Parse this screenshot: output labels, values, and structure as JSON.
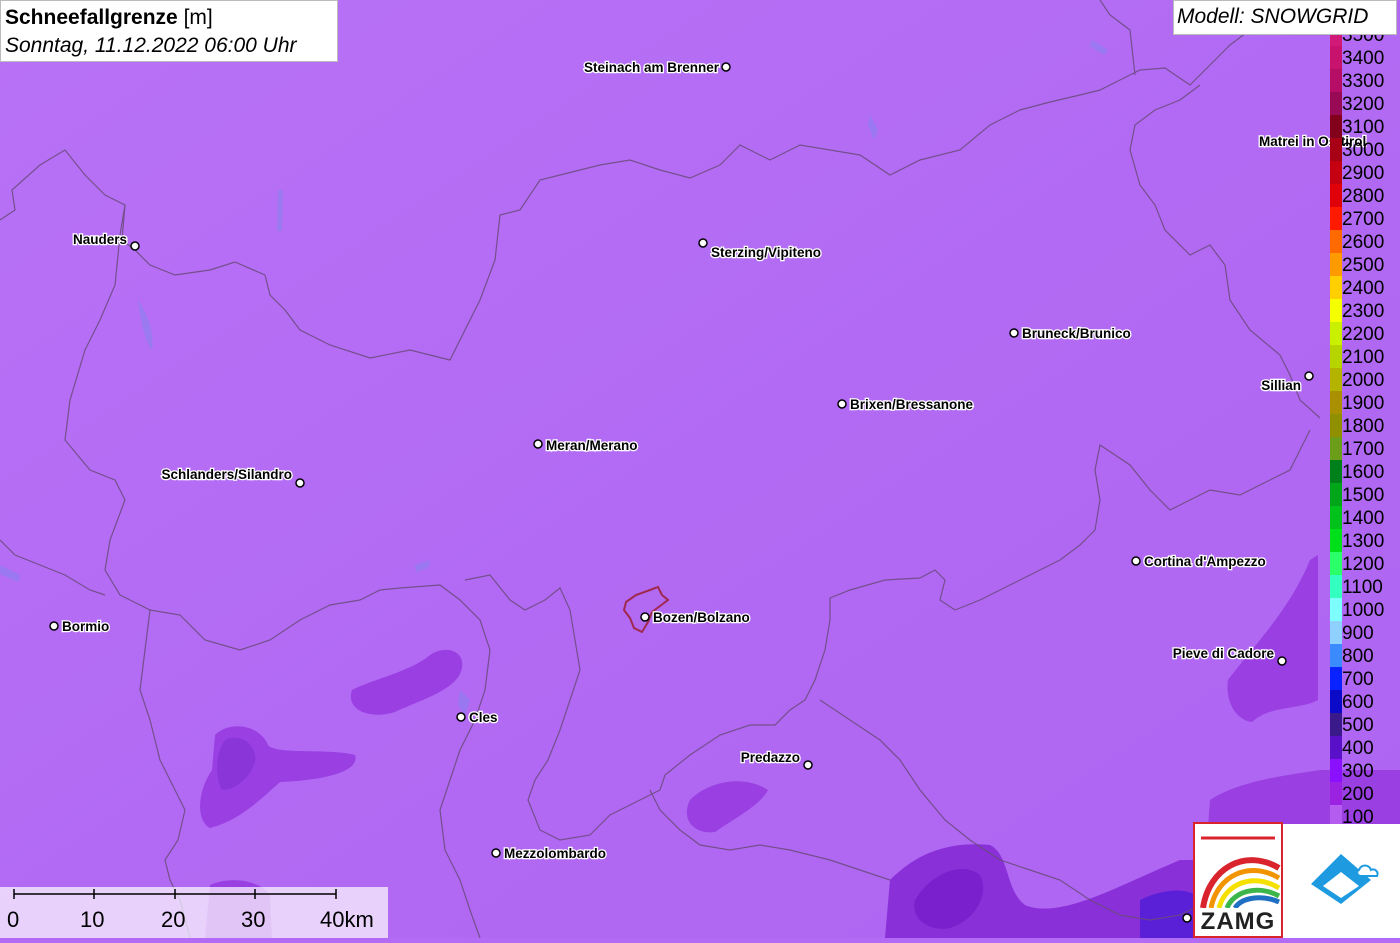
{
  "title": {
    "main": "Schneefallgrenze",
    "unit": "[m]",
    "datetime": "Sonntag, 11.12.2022 06:00 Uhr"
  },
  "model": "Modell: SNOWGRID",
  "legend": [
    {
      "label": "3500",
      "color": "#d11a78"
    },
    {
      "label": "3400",
      "color": "#c7136e"
    },
    {
      "label": "3300",
      "color": "#b60d66"
    },
    {
      "label": "3200",
      "color": "#990a56"
    },
    {
      "label": "3100",
      "color": "#82001b"
    },
    {
      "label": "3000",
      "color": "#a80014"
    },
    {
      "label": "2900",
      "color": "#c40011"
    },
    {
      "label": "2800",
      "color": "#e0000a"
    },
    {
      "label": "2700",
      "color": "#ff1a00"
    },
    {
      "label": "2600",
      "color": "#ff6a00"
    },
    {
      "label": "2500",
      "color": "#ff9a00"
    },
    {
      "label": "2400",
      "color": "#ffcf00"
    },
    {
      "label": "2300",
      "color": "#f5ff00"
    },
    {
      "label": "2200",
      "color": "#c8f000"
    },
    {
      "label": "2100",
      "color": "#b5d400"
    },
    {
      "label": "2000",
      "color": "#b3b300"
    },
    {
      "label": "1900",
      "color": "#a89000"
    },
    {
      "label": "1800",
      "color": "#8f8f00"
    },
    {
      "label": "1700",
      "color": "#6b9c1a"
    },
    {
      "label": "1600",
      "color": "#00801a"
    },
    {
      "label": "1500",
      "color": "#00a51a"
    },
    {
      "label": "1400",
      "color": "#00c21a"
    },
    {
      "label": "1300",
      "color": "#00e01a"
    },
    {
      "label": "1200",
      "color": "#2aff6a"
    },
    {
      "label": "1100",
      "color": "#33ffc0"
    },
    {
      "label": "1000",
      "color": "#7dffff"
    },
    {
      "label": "900",
      "color": "#8fd0ff"
    },
    {
      "label": "800",
      "color": "#3b8bff"
    },
    {
      "label": "700",
      "color": "#0a22ff"
    },
    {
      "label": "600",
      "color": "#0a0ac8"
    },
    {
      "label": "500",
      "color": "#3a1a8a"
    },
    {
      "label": "400",
      "color": "#5a10c8"
    },
    {
      "label": "300",
      "color": "#8a10ff"
    },
    {
      "label": "200",
      "color": "#9a22e0"
    },
    {
      "label": "100",
      "color": "#b45bf0"
    }
  ],
  "cities": [
    {
      "name": "Steinach am Brenner"
    },
    {
      "name": "Nauders"
    },
    {
      "name": "Sterzing/Vipiteno"
    },
    {
      "name": "Bruneck/Brunico"
    },
    {
      "name": "Matrei in Osttirol"
    },
    {
      "name": "Sillian"
    },
    {
      "name": "Brixen/Bressanone"
    },
    {
      "name": "Meran/Merano"
    },
    {
      "name": "Schlanders/Silandro"
    },
    {
      "name": "Cortina d'Ampezzo"
    },
    {
      "name": "Bormio"
    },
    {
      "name": "Bozen/Bolzano"
    },
    {
      "name": "Pieve di Cadore"
    },
    {
      "name": "Cles"
    },
    {
      "name": "Predazzo"
    },
    {
      "name": "Mezzolombardo"
    }
  ],
  "scale": {
    "labels": [
      "0",
      "10",
      "20",
      "30",
      "40km"
    ]
  },
  "logos": {
    "zamg_text": "ZAMG"
  },
  "colors": {
    "map_base": "#b36bf5",
    "low_zone": "#9d3fe6",
    "lower_zone": "#7d22d8",
    "border": "#6a4a7a",
    "bolzano_outline": "#a0294f"
  }
}
